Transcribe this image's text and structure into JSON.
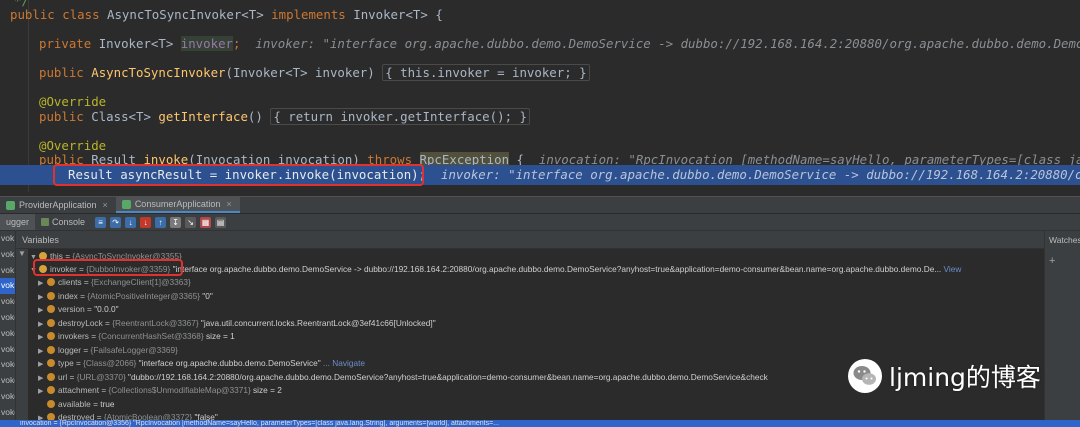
{
  "code": {
    "line0_comment": "*/",
    "class_decl": {
      "kw_public": "public",
      "kw_class": "class",
      "name": "AsyncToSyncInvoker",
      "generic": "<T>",
      "kw_implements": "implements",
      "iface": "Invoker",
      "iface_generic": "<T>",
      "brace": "{"
    },
    "field_line": {
      "kw_private": "private",
      "type": "Invoker",
      "generic": "<T>",
      "name": "invoker",
      "semi": ";",
      "hint": "invoker: \"interface org.apache.dubbo.demo.DemoService -> dubbo://192.168.164.2:20880/org.apache.dubbo.demo.DemoService"
    },
    "ctor_line": {
      "kw_public": "public",
      "name": "AsyncToSyncInvoker",
      "params": "(Invoker<T> invoker)",
      "body": "{ this.invoker = invoker; }"
    },
    "override1": "@Override",
    "getiface_line": {
      "kw_public": "public",
      "type": "Class<T>",
      "name": "getInterface",
      "parens": "()",
      "body": "{ return invoker.getInterface(); }"
    },
    "override2": "@Override",
    "invoke_line": {
      "kw_public": "public",
      "type": "Result",
      "name": "invoke",
      "params": "(Invocation invocation)",
      "kw_throws": "throws",
      "exc": "RpcException",
      "brace": "{",
      "hint": "invocation: \"RpcInvocation [methodName=sayHello, parameterTypes=[class java.l"
    },
    "current_line": {
      "stmt": "Result asyncResult = invoker.invoke(invocation);",
      "hint": "invoker: \"interface org.apache.dubbo.demo.DemoService -> dubbo://192.168.164.2:20880/org.a"
    }
  },
  "run_tabs": [
    {
      "label": "ProviderApplication",
      "active": false
    },
    {
      "label": "ConsumerApplication",
      "active": true
    }
  ],
  "toolbar": {
    "debugger_label": "ugger",
    "console_label": "Console"
  },
  "frames": [
    "vok",
    "vok",
    "vok",
    "vok",
    "voke",
    "voke",
    "voke",
    "voke",
    "voke",
    "voke",
    "voke",
    "voke",
    "Inv",
    "vok",
    "vok",
    "vok"
  ],
  "variables_header": "Variables",
  "watches_header": "Watches",
  "variables": [
    {
      "name": "this",
      "eq": " = ",
      "type": "{AsyncToSyncInvoker@3355}",
      "value": ""
    },
    {
      "name": "invoker",
      "eq": " = ",
      "type": "{DubboInvoker@3359}",
      "value": " \"interface org.apache.dubbo.demo.DemoService -> dubbo://192.168.164.2:20880/org.apache.dubbo.demo.DemoService?anyhost=true&application=demo-consumer&bean.name=org.apache.dubbo.demo.De...",
      "link": " View"
    },
    {
      "name": "clients",
      "eq": " = ",
      "type": "{ExchangeClient[1]@3363}",
      "value": ""
    },
    {
      "name": "index",
      "eq": " = ",
      "type": "{AtomicPositiveInteger@3365}",
      "value": " \"0\""
    },
    {
      "name": "version",
      "eq": " = ",
      "type": "",
      "value": "\"0.0.0\""
    },
    {
      "name": "destroyLock",
      "eq": " = ",
      "type": "{ReentrantLock@3367}",
      "value": " \"java.util.concurrent.locks.ReentrantLock@3ef41c66[Unlocked]\""
    },
    {
      "name": "invokers",
      "eq": " = ",
      "type": "{ConcurrentHashSet@3368}",
      "value": " size = 1"
    },
    {
      "name": "logger",
      "eq": " = ",
      "type": "{FailsafeLogger@3369}",
      "value": ""
    },
    {
      "name": "type",
      "eq": " = ",
      "type": "{Class@2066}",
      "value": " \"interface org.apache.dubbo.demo.DemoService\"",
      "link": " ... Navigate"
    },
    {
      "name": "url",
      "eq": " = ",
      "type": "{URL@3370}",
      "value": " \"dubbo://192.168.164.2:20880/org.apache.dubbo.demo.DemoService?anyhost=true&application=demo-consumer&bean.name=org.apache.dubbo.demo.DemoService&check"
    },
    {
      "name": "attachment",
      "eq": " = ",
      "type": "{Collections$UnmodifiableMap@3371}",
      "value": " size = 2"
    },
    {
      "name": "available",
      "eq": " = ",
      "type": "",
      "value": "true"
    },
    {
      "name": "destroyed",
      "eq": " = ",
      "type": "{AtomicBoolean@3372}",
      "value": " \"false\""
    }
  ],
  "bottom_row": "invocation = {RpcInvocation@3356} \"RpcInvocation [methodName=sayHello, parameterTypes=[class java.lang.String], arguments=[world], attachments=...",
  "watermark": {
    "text": "ljming的博客",
    "logo_icon": "wechat-logo-icon"
  },
  "colors": {
    "keyword": "#cc7832",
    "method": "#ffc66d",
    "field": "#9876aa",
    "annotation": "#bbb529",
    "current_line": "#2d5190",
    "highlight_box": "#e0322e",
    "selection": "#2f65ca"
  }
}
